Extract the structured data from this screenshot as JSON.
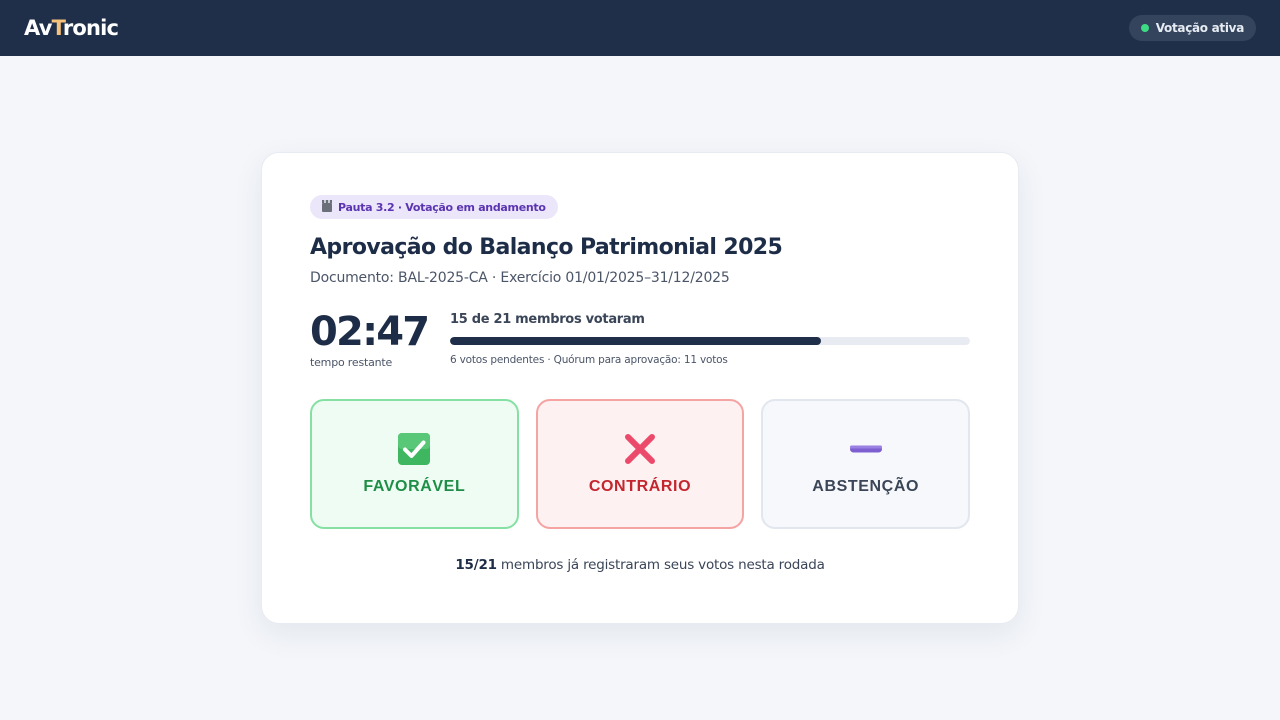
{
  "app": {
    "brand_prefix": "Av",
    "brand_accent": "T",
    "brand_suffix": "ronic",
    "status_label": "Votação ativa",
    "status_color": "#3ddc84"
  },
  "agenda": {
    "badge_label": "Pauta 3.2 · Votação em andamento",
    "badge_icon": "clapperboard-icon",
    "title": "Aprovação do Balanço Patrimonial 2025",
    "subtitle": "Documento: BAL-2025-CA · Exercício 01/01/2025–31/12/2025"
  },
  "timer": {
    "value": "02:47",
    "label": "tempo restante"
  },
  "progress": {
    "title": "15 de 21 membros votaram",
    "voted": 15,
    "total": 21,
    "note": "6 votos pendentes · Quórum para aprovação: 11 votos"
  },
  "votes": {
    "favor_label": "FAVORÁVEL",
    "favor_icon": "check-box-icon",
    "against_label": "CONTRÁRIO",
    "against_icon": "cross-mark-icon",
    "abstain_label": "ABSTENÇÃO",
    "abstain_icon": "minus-icon"
  },
  "footer": {
    "count": "15/21",
    "text": " membros já registraram seus votos nesta rodada"
  },
  "colors": {
    "header_bg": "#1f2f4a",
    "favor": "#1e8e46",
    "against": "#c3262e",
    "abstain": "#3a4558"
  }
}
